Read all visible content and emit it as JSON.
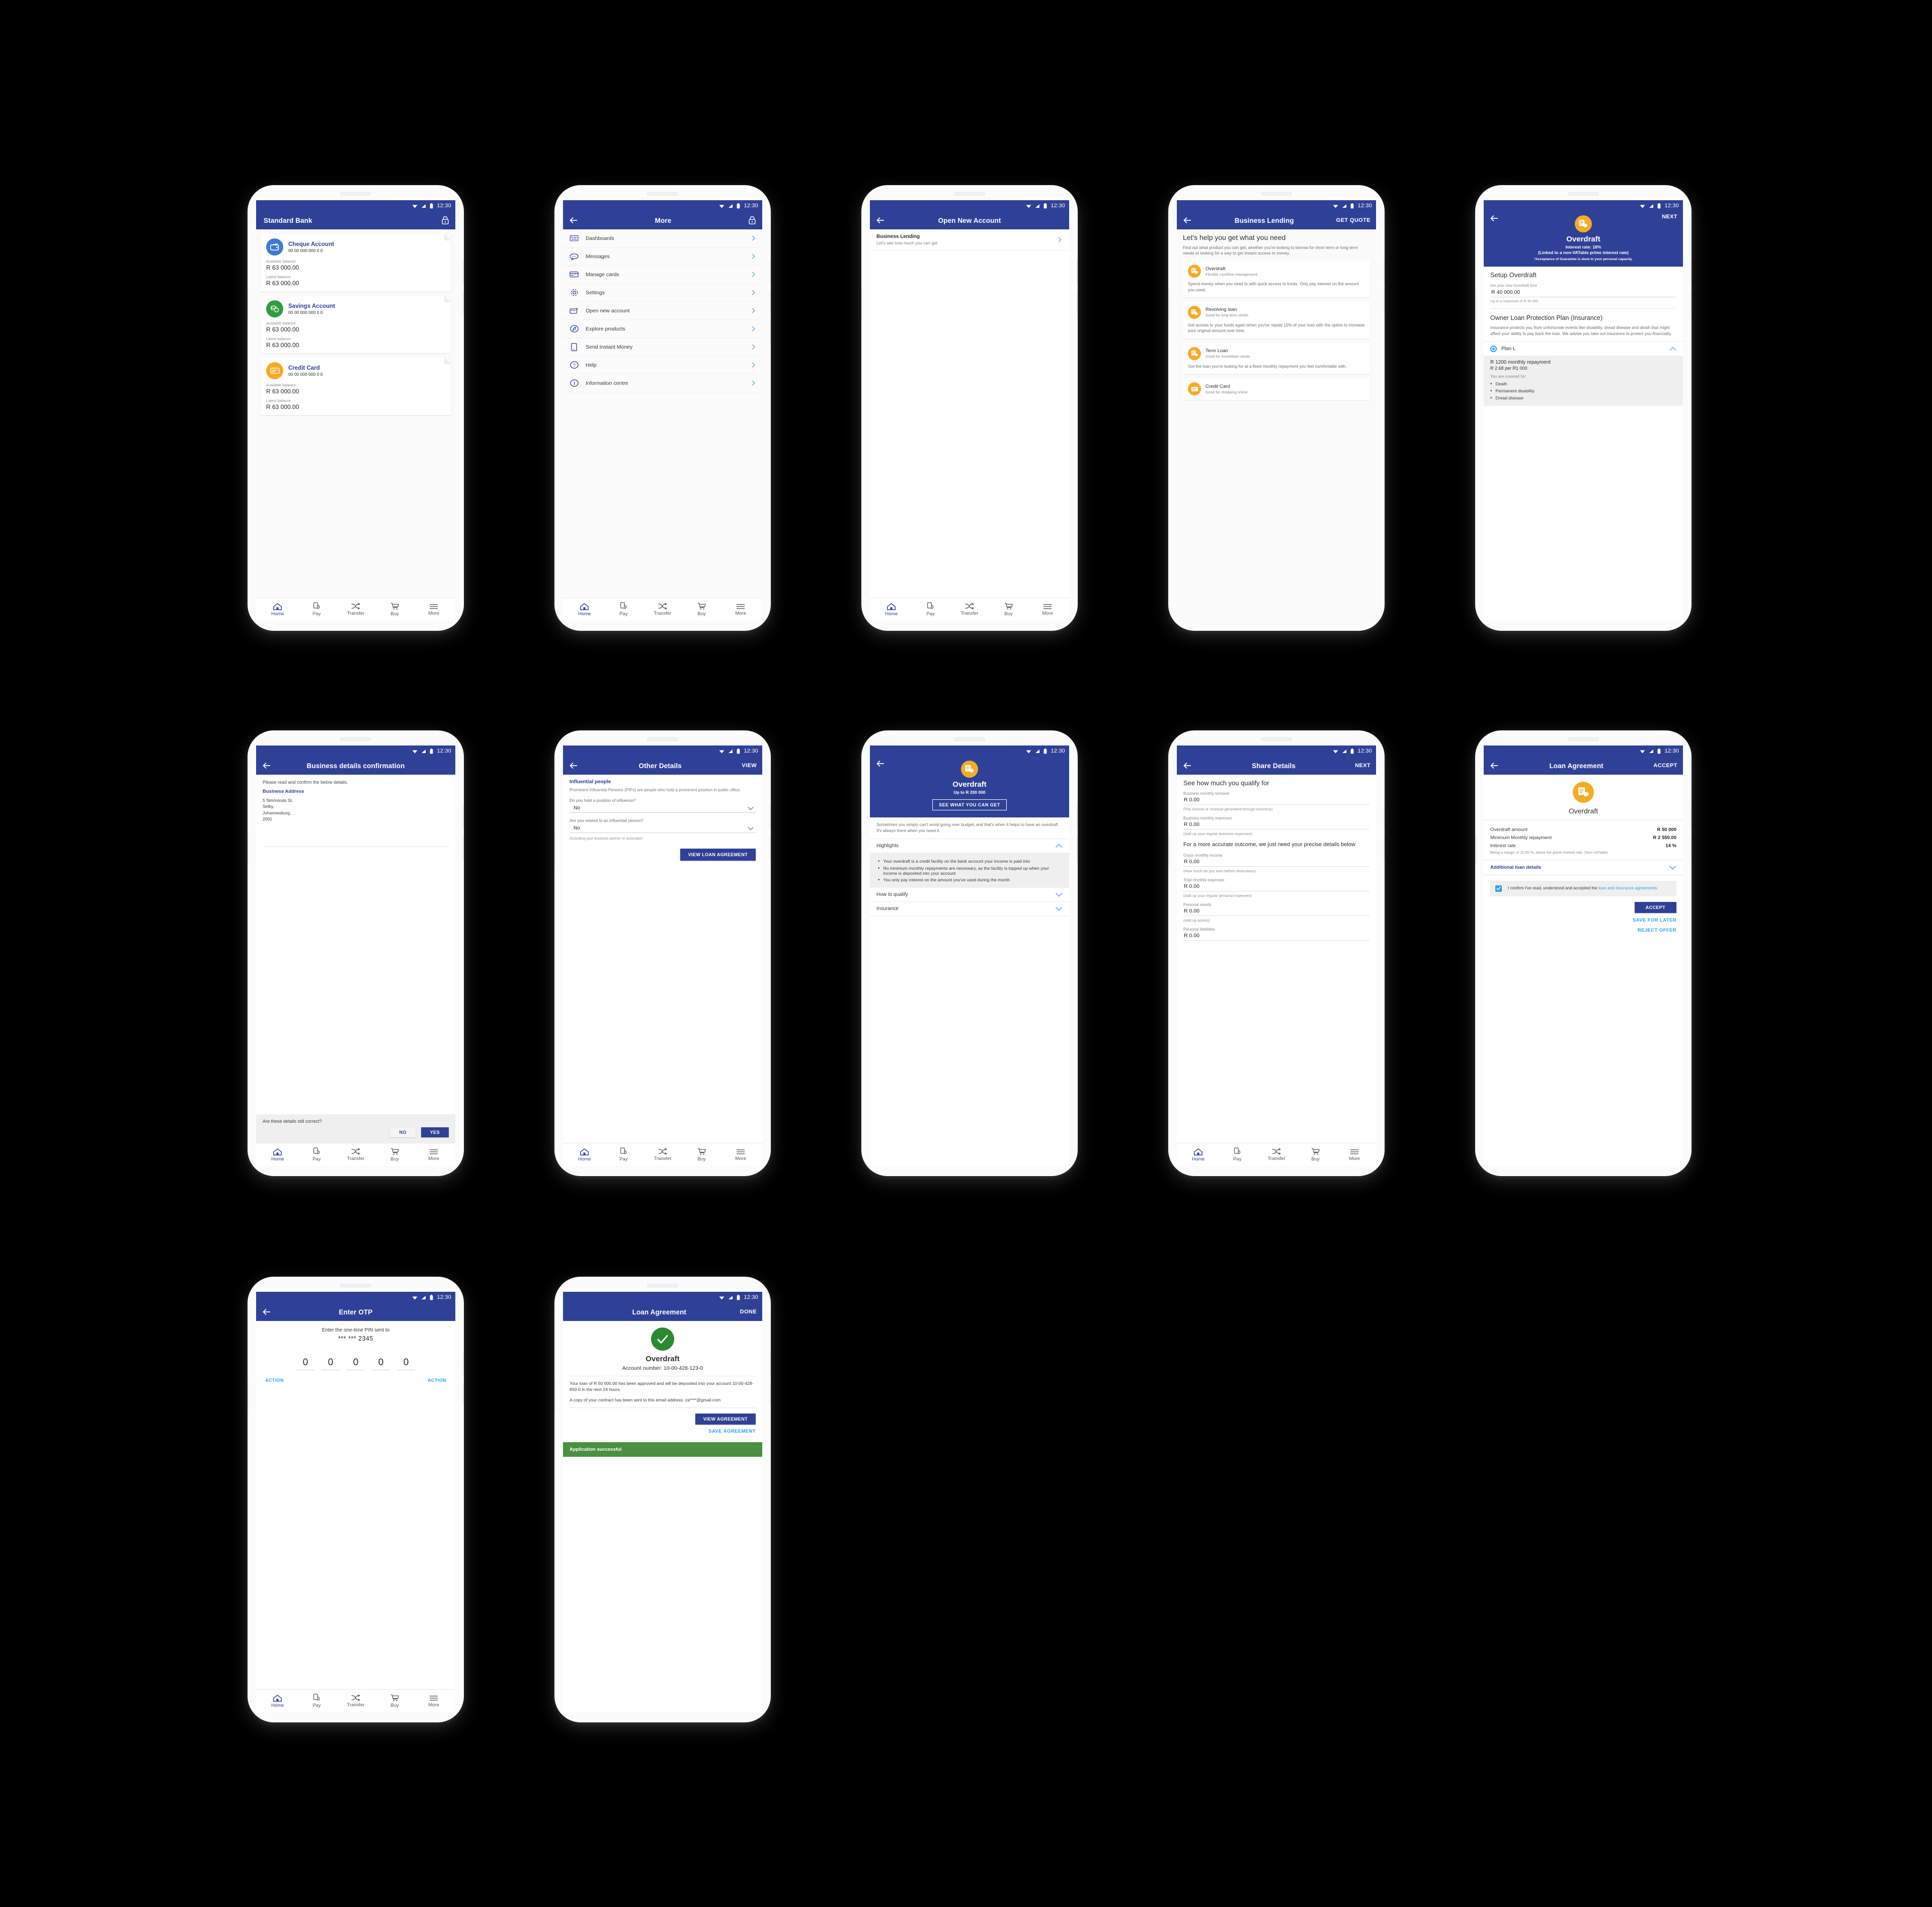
{
  "common": {
    "status_time": "12:30",
    "bottom_nav": [
      {
        "label": "Home",
        "icon": "home-icon"
      },
      {
        "label": "Pay",
        "icon": "pay-icon"
      },
      {
        "label": "Transfer",
        "icon": "transfer-icon"
      },
      {
        "label": "Buy",
        "icon": "cart-icon"
      },
      {
        "label": "More",
        "icon": "hamburger-icon"
      }
    ],
    "colors": {
      "brand_blue": "#2f4196",
      "accent_amber": "#f6ab27",
      "link_blue": "#29a3e6",
      "success_green": "#2a8a2f",
      "bar_green": "#4a9042",
      "savings_green": "#2f9e3f",
      "cheque_blue": "#3d7bd1"
    }
  },
  "s1_home": {
    "title": "Standard Bank",
    "lock_icon": "lock-icon",
    "accounts": [
      {
        "name": "Cheque Account",
        "number": "00 00 000 000 0 0",
        "available_label": "Available balance",
        "available": "R 63 000.00",
        "latest_label": "Latest balance",
        "latest": "R 63 000.00",
        "icon": "wallet-icon",
        "color": "#3d7bd1"
      },
      {
        "name": "Savings Account",
        "number": "00 00 000 000 0 0",
        "available_label": "Available balance",
        "available": "R 63 000.00",
        "latest_label": "Latest balance",
        "latest": "R 63 000.00",
        "icon": "coins-icon",
        "color": "#2f9e3f"
      },
      {
        "name": "Credit Card",
        "number": "00 00 000 000 0 0",
        "available_label": "Available balance",
        "available": "R 63 000.00",
        "latest_label": "Latest balance",
        "latest": "R 63 000.00",
        "icon": "card-icon",
        "color": "#f6ab27"
      }
    ]
  },
  "s2_more": {
    "title": "More",
    "lock_icon": "lock-icon",
    "items": [
      {
        "label": "Dashboards",
        "icon": "dashboard-icon"
      },
      {
        "label": "Messages",
        "icon": "message-icon"
      },
      {
        "label": "Manage cards",
        "icon": "card-icon"
      },
      {
        "label": "Settings",
        "icon": "gear-icon"
      },
      {
        "label": "Open new account",
        "icon": "add-card-icon"
      },
      {
        "label": "Explore products",
        "icon": "compass-icon"
      },
      {
        "label": "Send Instant Money",
        "icon": "phone-icon"
      },
      {
        "label": "Help",
        "icon": "question-icon"
      },
      {
        "label": "Information centre",
        "icon": "info-icon"
      }
    ]
  },
  "s3_open_account": {
    "title": "Open New Account",
    "rows": [
      {
        "title": "Business Lending",
        "subtitle": "Let's see how much you can get"
      }
    ]
  },
  "s4_business_lending": {
    "title": "Business Lending",
    "action": "GET QUOTE",
    "heading": "Let's help you get what you need",
    "intro": "Find out what product you can get; whether you're looking to borrow for short term or long-term needs or looking for a way to get instant access to money.",
    "products": [
      {
        "name": "Overdraft",
        "sub": "Flexible cashflow management.",
        "desc": "Spend money when you need to with quick access to funds. Only pay interest on the amount you used.",
        "icon": "invoice-coins-icon"
      },
      {
        "name": "Revolving loan",
        "sub": "Good for long term needs",
        "desc": "Get access to your funds again when you've repaid 15% of your loan with the option to increase your original amount over time.",
        "icon": "invoice-coins-icon"
      },
      {
        "name": "Term Loan",
        "sub": "Good for immediate needs",
        "desc": "Get the loan you're looking for at a fixed monthly repayment you feel comfortable with.",
        "icon": "invoice-coins-icon"
      },
      {
        "name": "Credit Card",
        "sub": "Good for shopping online",
        "desc": "",
        "icon": "card-icon"
      }
    ]
  },
  "s5_setup_overdraft": {
    "action": "NEXT",
    "hero_icon": "invoice-coins-icon",
    "hero_title": "Overdraft",
    "hero_sub_1": "Interest rate: 18%",
    "hero_sub_2": "(Linked to a non-VATable prime interest rate)",
    "hero_note": "*Acceptance of Guarantee is done in your personal capacity.",
    "section_title": "Setup Overdraft",
    "limit_label": "Set your new Overdraft limit",
    "limit_value": "R   40 000.00",
    "limit_hint": "Up to a maximum of R 40 000",
    "insurance_title": "Owner Loan Protection Plan (Insurance)",
    "insurance_body": "Insurance protects you from unfortunate events like disability, dread disease and death that might affect your ability to pay back the loan. We advise you take out insurance to protect you financially.",
    "plan_name": "Plan L",
    "plan_repayment": "R 1200 monthly repayment",
    "plan_rate": "R 2.68 per R1 000",
    "covered_label": "You are covered for:",
    "covered": [
      "Death",
      "Permanent disability",
      "Dread disease"
    ]
  },
  "s6_business_confirm": {
    "title": "Business details confirmation",
    "intro": "Please read and confirm the below details.",
    "section_label": "Business Address",
    "address": "5 Simmonds St,\nSelby,\nJohannesburg,\n2001",
    "question": "Are these details still correct?",
    "btn_no": "NO",
    "btn_yes": "YES"
  },
  "s7_other_details": {
    "title": "Other Details",
    "action": "VIEW",
    "heading": "Influential people",
    "description": "Prominent Influential Persons (PIPs) are people who hold a prominent position in public office.",
    "q1_label": "Do you hold a position of influence?",
    "q1_value": "No",
    "q2_label": "Are you related to an influential person?",
    "q2_value": "No",
    "q2_hint": "(Including your business partner or associate)",
    "cta": "VIEW LOAN AGREEMENT"
  },
  "s8_overdraft_info": {
    "hero_icon": "invoice-coins-icon",
    "hero_title": "Overdraft",
    "hero_sub": "Up to R 200 000",
    "hero_btn": "SEE WHAT YOU CAN GET",
    "intro": "Sometimes you simply can't avoid going over budget, and that's when it helps to have an overdraft. It's always there when you need it.",
    "acc_highlights": "Highlights",
    "highlights": [
      "Your overdraft is a credit facility on the bank account your income is paid into",
      "No minimum monthly repayments are necessary, as the facility is topped up when your income is deposited into your account",
      "You only pay interest on the amount you've used during the month"
    ],
    "acc_how": "How to qualify",
    "acc_insurance": "Insurance"
  },
  "s9_share_details": {
    "title": "Share Details",
    "action": "NEXT",
    "heading": "See how much you qualify for",
    "fields_a": [
      {
        "label": "Business monthly turnover",
        "value": "R 0.00",
        "hint": "(The income or revenue generated through business)"
      },
      {
        "label": "Business monthly expenses",
        "value": "R 0.00",
        "hint": "(Add up your regular business expenses)"
      }
    ],
    "subheading": "For a more accurate outcome, we just need your precise details below",
    "fields_b": [
      {
        "label": "Gross monthly income",
        "value": "R 0.00",
        "hint": "(How much do you earn before deductions)"
      },
      {
        "label": "Total monthly expenses",
        "value": "R 0.00",
        "hint": "(Add up your regular personal expenses)"
      },
      {
        "label": "Personal assets",
        "value": "R 0.00",
        "hint": "(Add up assets)"
      },
      {
        "label": "Personal liabilities",
        "value": "R 0.00",
        "hint": ""
      }
    ]
  },
  "s10_loan_agreement": {
    "title": "Loan Agreement",
    "action": "ACCEPT",
    "icon": "invoice-coins-icon",
    "product": "Overdraft",
    "rows": [
      {
        "key": "Overdraft amount",
        "value": "R 50 000"
      },
      {
        "key": "Minimum Monthly repayment",
        "value": "R 2 550.00"
      },
      {
        "key": "Interest rate",
        "value": "14 %"
      }
    ],
    "rate_note": "Being a margin of 10.50 %, above the prime interest rate. (Non-VATable)",
    "accordion": "Additional loan details",
    "confirm_text_a": "I confirm I've read, understood and accepted the ",
    "confirm_link": "loan and insurance agreements.",
    "btn_accept": "ACCEPT",
    "link_save": "SAVE FOR LATER",
    "link_reject": "REJECT OFFER"
  },
  "s11_otp": {
    "title": "Enter OTP",
    "prompt": "Enter the one-time PIN sent to",
    "masked_number": "*** *** 2345",
    "digits": [
      "0",
      "0",
      "0",
      "0",
      "0"
    ],
    "action_left": "ACTION",
    "action_right": "ACTION"
  },
  "s12_success": {
    "title": "Loan Agreement",
    "action": "DONE",
    "icon": "check-icon",
    "product": "Overdraft",
    "account_line": "Account number:   10-00-428-123-0",
    "para_1": "Your loan of R 50 000.00 has been approved and will be deposited into your account 10-00-428-650-0 in the next 24 hours.",
    "para_2": "A copy of your contract has been sent to this email address: za****@gmail.com",
    "btn_view": "VIEW AGREEMENT",
    "link_save": "SAVE AGREEMENT",
    "status_bar": "Application successful"
  }
}
